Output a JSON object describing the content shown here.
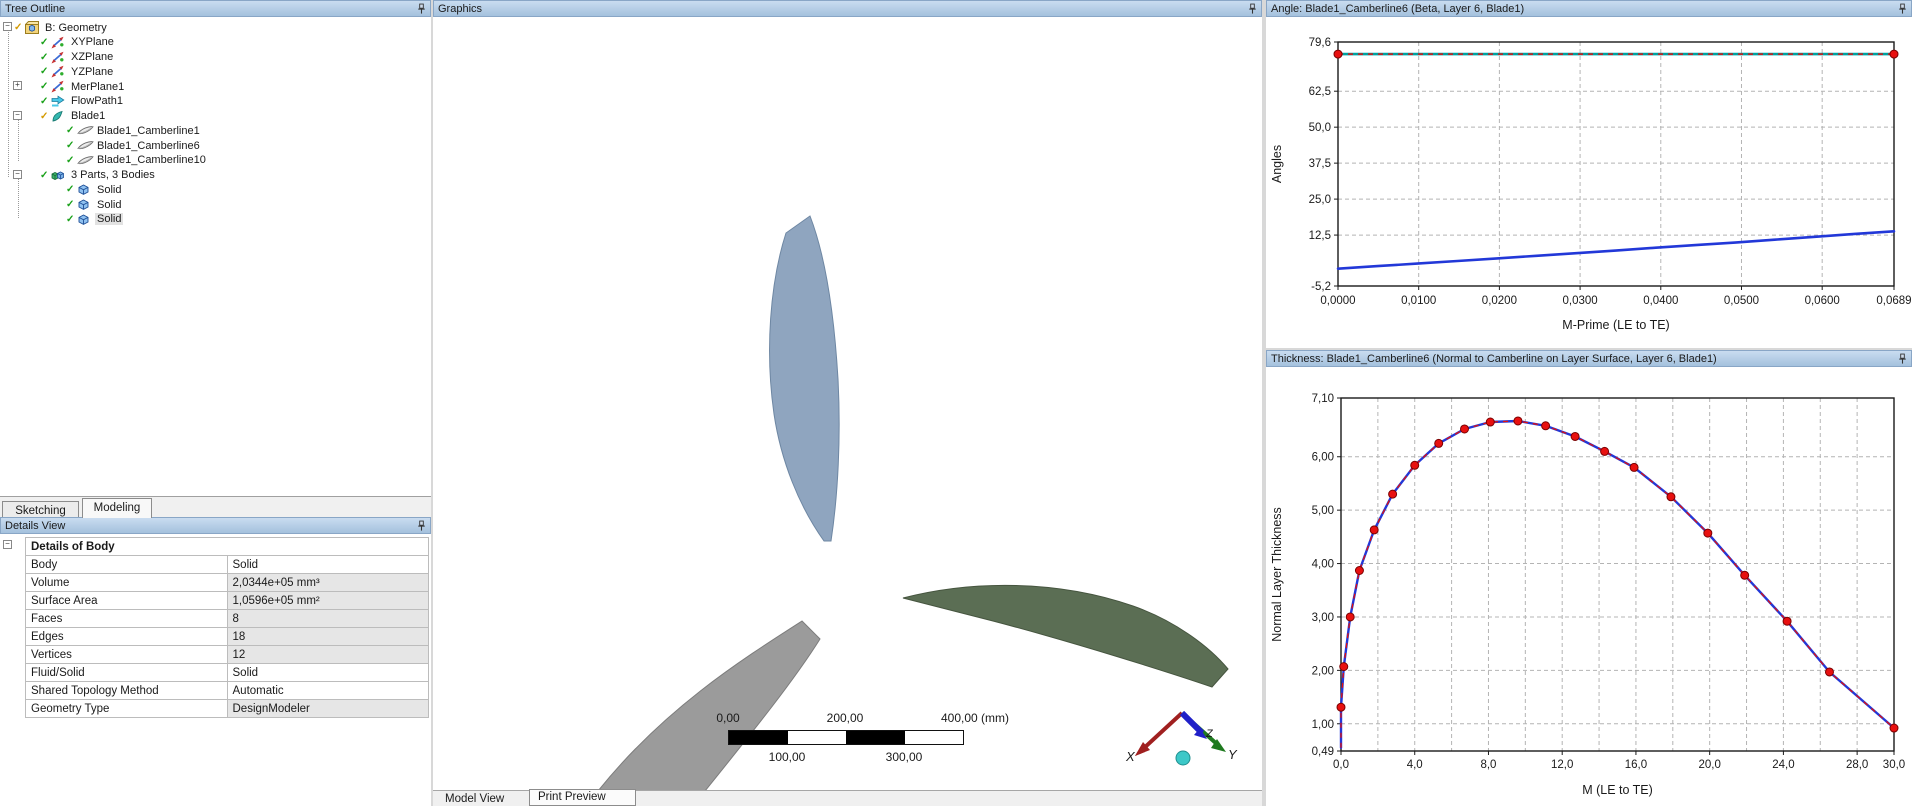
{
  "left_panel": {
    "tree_header": {
      "title": "Tree Outline"
    },
    "tree": {
      "items": [
        {
          "label": "B: Geometry",
          "depth": 0,
          "expander": "minus",
          "check": "amber",
          "icon": "geometry-icon"
        },
        {
          "label": "XYPlane",
          "depth": 1,
          "expander": null,
          "check": "green",
          "icon": "plane-icon"
        },
        {
          "label": "XZPlane",
          "depth": 1,
          "expander": null,
          "check": "green",
          "icon": "plane-icon"
        },
        {
          "label": "YZPlane",
          "depth": 1,
          "expander": null,
          "check": "green",
          "icon": "plane-icon"
        },
        {
          "label": "MerPlane1",
          "depth": 1,
          "expander": "plus",
          "check": "green",
          "icon": "plane-icon"
        },
        {
          "label": "FlowPath1",
          "depth": 1,
          "expander": null,
          "check": "green",
          "icon": "flowpath-icon"
        },
        {
          "label": "Blade1",
          "depth": 1,
          "expander": "minus",
          "check": "amber",
          "icon": "blade-icon"
        },
        {
          "label": "Blade1_Camberline1",
          "depth": 2,
          "expander": null,
          "check": "green",
          "icon": "camberline-icon"
        },
        {
          "label": "Blade1_Camberline6",
          "depth": 2,
          "expander": null,
          "check": "green",
          "icon": "camberline-icon"
        },
        {
          "label": "Blade1_Camberline10",
          "depth": 2,
          "expander": null,
          "check": "green",
          "icon": "camberline-icon"
        },
        {
          "label": "3 Parts, 3 Bodies",
          "depth": 1,
          "expander": "minus",
          "check": "green",
          "icon": "parts-icon"
        },
        {
          "label": "Solid",
          "depth": 2,
          "expander": null,
          "check": "green",
          "icon": "solid-icon"
        },
        {
          "label": "Solid",
          "depth": 2,
          "expander": null,
          "check": "green",
          "icon": "solid-icon"
        },
        {
          "label": "Solid",
          "depth": 2,
          "expander": null,
          "check": "green",
          "icon": "solid-icon",
          "selected": true
        }
      ]
    },
    "mode_tabs": [
      {
        "label": "Sketching",
        "active": false
      },
      {
        "label": "Modeling",
        "active": true
      }
    ],
    "details_header": {
      "title": "Details View"
    },
    "details": {
      "group_title": "Details of Body",
      "rows": [
        {
          "label": "Body",
          "value": "Solid",
          "shaded": false
        },
        {
          "label": "Volume",
          "value": "2,0344e+05 mm³",
          "shaded": true
        },
        {
          "label": "Surface Area",
          "value": "1,0596e+05 mm²",
          "shaded": true
        },
        {
          "label": "Faces",
          "value": "8",
          "shaded": true
        },
        {
          "label": "Edges",
          "value": "18",
          "shaded": true
        },
        {
          "label": "Vertices",
          "value": "12",
          "shaded": true
        },
        {
          "label": "Fluid/Solid",
          "value": "Solid",
          "shaded": false
        },
        {
          "label": "Shared Topology Method",
          "value": "Automatic",
          "shaded": false
        },
        {
          "label": "Geometry Type",
          "value": "DesignModeler",
          "shaded": true
        }
      ]
    }
  },
  "graphics": {
    "header": {
      "title": "Graphics"
    },
    "ruler": {
      "top_labels": [
        "0,00",
        "200,00",
        "400,00 (mm)"
      ],
      "bottom_labels": [
        "100,00",
        "300,00"
      ]
    },
    "triad": {
      "x_label": "X",
      "y_label": "Y",
      "z_label": "Z",
      "x_color": "#e25a5a",
      "y_color": "#2fae2f",
      "z_color": "#4646d8"
    },
    "bottom_tabs": [
      {
        "label": "Model View",
        "active": true
      },
      {
        "label": "Print Preview",
        "active": false
      }
    ],
    "blade_colors": {
      "blue": "#8fa5bf",
      "green": "#5b6e54",
      "gray": "#9b9b9b"
    }
  },
  "chart_data": [
    {
      "type": "line",
      "title": "Angle: Blade1_Camberline6 (Beta, Layer 6, Blade1)",
      "xlabel": "M-Prime (LE to TE)",
      "ylabel": "Angles",
      "xlim": [
        0,
        0.0689
      ],
      "ylim": [
        -5.2,
        79.6
      ],
      "grid": "dashed",
      "legend": "none",
      "x_ticks": [
        "0,0000",
        "0,0100",
        "0,0200",
        "0,0300",
        "0,0400",
        "0,0500",
        "0,0600",
        "0,0689"
      ],
      "x_tick_vals": [
        0,
        0.01,
        0.02,
        0.03,
        0.04,
        0.05,
        0.06,
        0.0689
      ],
      "y_ticks": [
        "79,6",
        "62,5",
        "50,0",
        "37,5",
        "25,0",
        "12,5",
        "-5,2"
      ],
      "y_tick_vals": [
        79.6,
        62.5,
        50.0,
        37.5,
        25.0,
        12.5,
        -5.2
      ],
      "x_grid_vals": [
        0.01,
        0.02,
        0.03,
        0.04,
        0.05,
        0.06
      ],
      "y_grid_vals": [
        62.5,
        50.0,
        37.5,
        25.0,
        12.5
      ],
      "series": [
        {
          "name": "theta-constant",
          "color": "#00a0a0",
          "width": 2.6,
          "dash_overlay": "#e01010",
          "markers": "ends",
          "x": [
            0,
            0.0689
          ],
          "y": [
            75.4,
            75.4
          ]
        },
        {
          "name": "beta-angle",
          "color": "#2238d8",
          "width": 2.6,
          "dash_overlay": null,
          "markers": "none",
          "x": [
            0,
            0.0049,
            0.0098,
            0.0148,
            0.0197,
            0.0246,
            0.0295,
            0.0344,
            0.0394,
            0.0443,
            0.0492,
            0.0541,
            0.0591,
            0.064,
            0.0689
          ],
          "y": [
            0.8,
            1.7,
            2.6,
            3.5,
            4.4,
            5.3,
            6.2,
            7.1,
            8.1,
            9.0,
            9.9,
            10.9,
            11.9,
            12.9,
            13.8
          ]
        }
      ]
    },
    {
      "type": "line",
      "title": "Thickness: Blade1_Camberline6 (Normal to Camberline on Layer Surface, Layer 6, Blade1)",
      "xlabel": "M (LE to TE)",
      "ylabel": "Normal Layer Thickness",
      "xlim": [
        0,
        30
      ],
      "ylim": [
        0.49,
        7.1
      ],
      "grid": "dashed",
      "legend": "none",
      "x_ticks": [
        "0,0",
        "4,0",
        "8,0",
        "12,0",
        "16,0",
        "20,0",
        "24,0",
        "28,0",
        "30,0"
      ],
      "x_tick_vals": [
        0,
        4,
        8,
        12,
        16,
        20,
        24,
        28,
        30
      ],
      "y_ticks": [
        "7,10",
        "6,00",
        "5,00",
        "4,00",
        "3,00",
        "2,00",
        "1,00",
        "0,49"
      ],
      "y_tick_vals": [
        7.1,
        6.0,
        5.0,
        4.0,
        3.0,
        2.0,
        1.0,
        0.49
      ],
      "x_grid_vals": [
        2,
        4,
        6,
        8,
        10,
        12,
        14,
        16,
        18,
        20,
        22,
        24,
        26,
        28
      ],
      "y_grid_vals": [
        6.0,
        5.0,
        4.0,
        3.0,
        2.0,
        1.0
      ],
      "series": [
        {
          "name": "normal-layer-thickness",
          "color": "#2238d8",
          "width": 2.4,
          "dash_overlay": "#e01010",
          "markers": "all",
          "line_pre": [
            [
              0,
              0.55
            ]
          ],
          "x": [
            0,
            0.15,
            0.5,
            1.0,
            1.8,
            2.8,
            4.0,
            5.3,
            6.7,
            8.1,
            9.6,
            11.1,
            12.7,
            14.3,
            15.9,
            17.9,
            19.9,
            21.9,
            24.2,
            26.5,
            30.0
          ],
          "y": [
            1.31,
            2.07,
            3.0,
            3.87,
            4.63,
            5.3,
            5.84,
            6.25,
            6.52,
            6.65,
            6.67,
            6.58,
            6.38,
            6.1,
            5.8,
            5.25,
            4.57,
            3.78,
            2.92,
            1.97,
            0.92
          ]
        }
      ]
    }
  ]
}
